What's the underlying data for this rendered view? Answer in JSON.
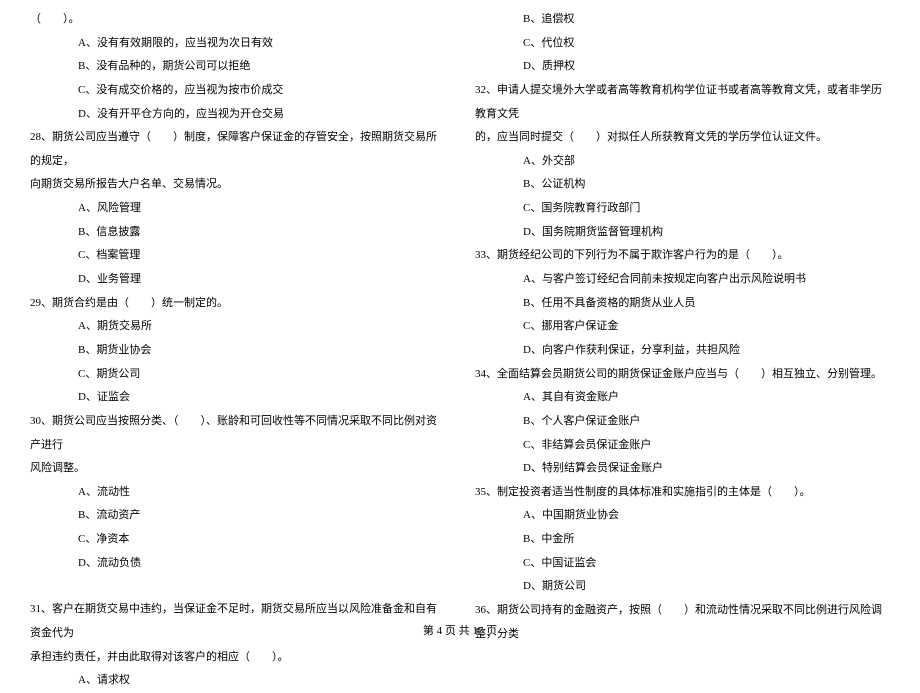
{
  "left": {
    "q27_tail": "（　　）。",
    "q27_a": "A、没有有效期限的，应当视为次日有效",
    "q27_b": "B、没有品种的，期货公司可以拒绝",
    "q27_c": "C、没有成交价格的，应当视为按市价成交",
    "q27_d": "D、没有开平仓方向的，应当视为开仓交易",
    "q28": "28、期货公司应当遵守（　　）制度，保障客户保证金的存管安全，按照期货交易所的规定，",
    "q28_cont": "向期货交易所报告大户名单、交易情况。",
    "q28_a": "A、风险管理",
    "q28_b": "B、信息披露",
    "q28_c": "C、档案管理",
    "q28_d": "D、业务管理",
    "q29": "29、期货合约是由（　　）统一制定的。",
    "q29_a": "A、期货交易所",
    "q29_b": "B、期货业协会",
    "q29_c": "C、期货公司",
    "q29_d": "D、证监会",
    "q30": "30、期货公司应当按照分类、（　　）、账龄和可回收性等不同情况采取不同比例对资产进行",
    "q30_cont": "风险调整。",
    "q30_a": "A、流动性",
    "q30_b": "B、流动资产",
    "q30_c": "C、净资本",
    "q30_d": "D、流动负债",
    "q31": "31、客户在期货交易中违约，当保证金不足时，期货交易所应当以风险准备金和自有资金代为",
    "q31_cont": "承担违约责任，并由此取得对该客户的相应（　　）。",
    "q31_a": "A、请求权"
  },
  "right": {
    "q31_b": "B、追偿权",
    "q31_c": "C、代位权",
    "q31_d": "D、质押权",
    "q32": "32、申请人提交境外大学或者高等教育机构学位证书或者高等教育文凭，或者非学历教育文凭",
    "q32_cont": "的，应当同时提交（　　）对拟任人所获教育文凭的学历学位认证文件。",
    "q32_a": "A、外交部",
    "q32_b": "B、公证机构",
    "q32_c": "C、国务院教育行政部门",
    "q32_d": "D、国务院期货监督管理机构",
    "q33": "33、期货经纪公司的下列行为不属于欺诈客户行为的是（　　）。",
    "q33_a": "A、与客户签订经纪合同前未按规定向客户出示风险说明书",
    "q33_b": "B、任用不具备资格的期货从业人员",
    "q33_c": "C、挪用客户保证金",
    "q33_d": "D、向客户作获利保证，分享利益，共担风险",
    "q34": "34、全面结算会员期货公司的期货保证金账户应当与（　　）相互独立、分别管理。",
    "q34_a": "A、其自有资金账户",
    "q34_b": "B、个人客户保证金账户",
    "q34_c": "C、非结算会员保证金账户",
    "q34_d": "D、特别结算会员保证金账户",
    "q35": "35、制定投资者适当性制度的具体标准和实施指引的主体是（　　）。",
    "q35_a": "A、中国期货业协会",
    "q35_b": "B、中金所",
    "q35_c": "C、中国证监会",
    "q35_d": "D、期货公司",
    "q36": "36、期货公司持有的金融资产，按照（　　）和流动性情况采取不同比例进行风险调整，分类"
  },
  "footer": "第 4 页  共 17 页"
}
